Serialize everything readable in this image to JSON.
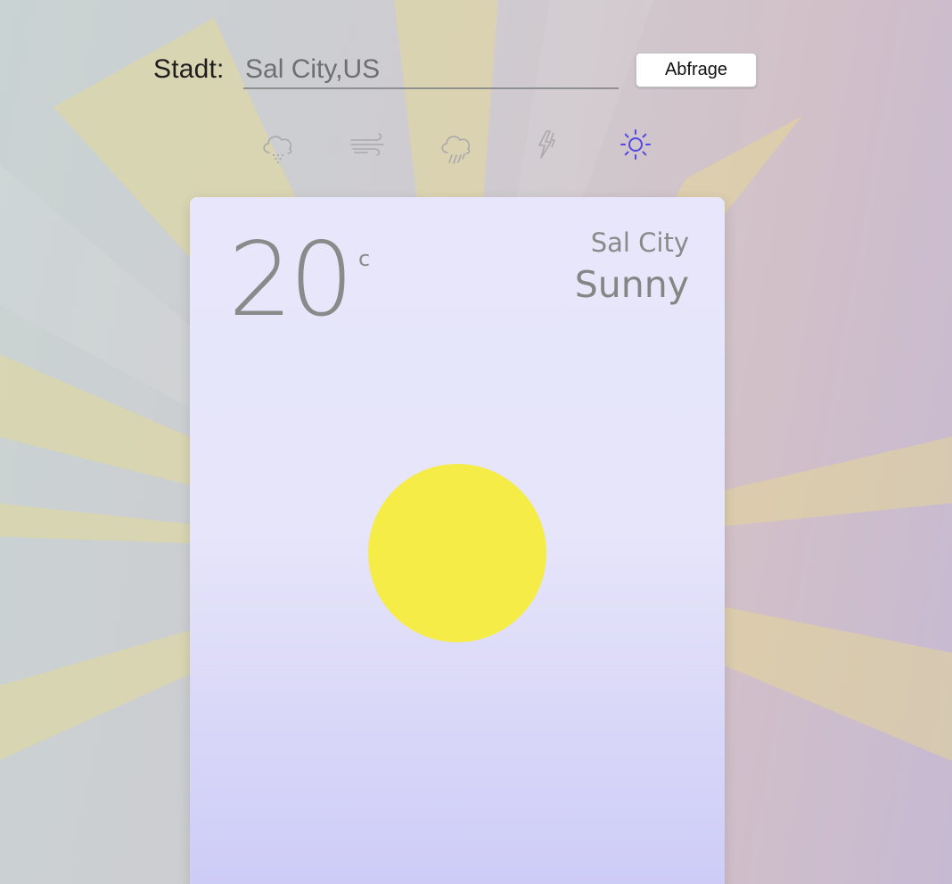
{
  "search": {
    "label": "Stadt:",
    "input_value": "Sal City,US",
    "button_label": "Abfrage"
  },
  "weather_icons": [
    {
      "name": "snow-cloud-icon",
      "selected": false
    },
    {
      "name": "wind-icon",
      "selected": false
    },
    {
      "name": "rain-cloud-icon",
      "selected": false
    },
    {
      "name": "lightning-icon",
      "selected": false
    },
    {
      "name": "sun-icon",
      "selected": true
    }
  ],
  "card": {
    "temperature": "20",
    "unit": "c",
    "city": "Sal City",
    "condition": "Sunny"
  },
  "colors": {
    "sun": "#f5ec47",
    "selected_icon": "#5348e6",
    "inactive_icon": "#a9a9ac",
    "card_text": "#8a8a8a"
  }
}
